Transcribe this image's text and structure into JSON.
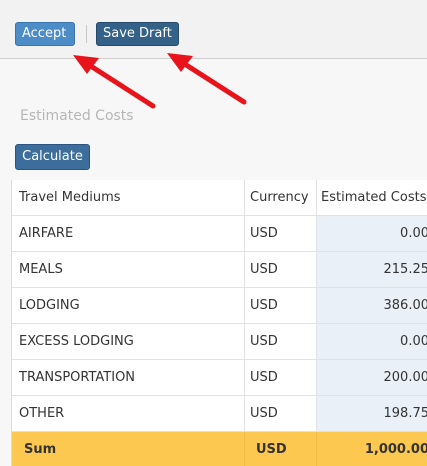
{
  "toolbar": {
    "accept_label": "Accept",
    "save_draft_label": "Save Draft"
  },
  "section": {
    "title": "Estimated Costs",
    "calculate_label": "Calculate"
  },
  "table": {
    "columns": [
      "Travel Mediums",
      "Currency",
      "Estimated Costs"
    ],
    "rows": [
      {
        "medium": "AIRFARE",
        "currency": "USD",
        "cost": "0.00"
      },
      {
        "medium": "MEALS",
        "currency": "USD",
        "cost": "215.25"
      },
      {
        "medium": "LODGING",
        "currency": "USD",
        "cost": "386.00"
      },
      {
        "medium": "EXCESS LODGING",
        "currency": "USD",
        "cost": "0.00"
      },
      {
        "medium": "TRANSPORTATION",
        "currency": "USD",
        "cost": "200.00"
      },
      {
        "medium": "OTHER",
        "currency": "USD",
        "cost": "198.75"
      }
    ],
    "sum": {
      "label": "Sum",
      "currency": "USD",
      "cost": "1,000.00"
    }
  },
  "colors": {
    "accept_button": "#4c8cc7",
    "save_draft_button": "#346187",
    "calculate_button": "#3d6e9b",
    "sum_row": "#fdc84f",
    "cost_column": "#e9f0f8",
    "annotation_arrow": "#e8131b"
  },
  "icons": [
    "red-arrow-icon"
  ]
}
